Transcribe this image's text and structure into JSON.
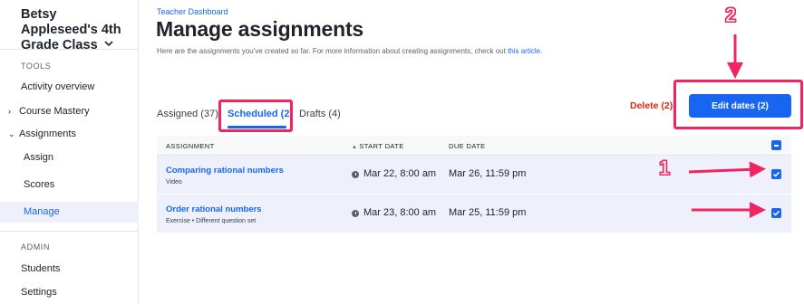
{
  "sidebar": {
    "class_name": "Betsy Appleseed's 4th Grade Class",
    "tools_heading": "TOOLS",
    "items": [
      {
        "label": "Activity overview"
      },
      {
        "label": "Course Mastery"
      },
      {
        "label": "Assignments"
      },
      {
        "label": "Assign"
      },
      {
        "label": "Scores"
      },
      {
        "label": "Manage"
      }
    ],
    "admin_heading": "ADMIN",
    "admin_items": [
      {
        "label": "Students"
      },
      {
        "label": "Settings"
      }
    ]
  },
  "header": {
    "breadcrumb": "Teacher Dashboard",
    "title": "Manage assignments",
    "subtitle": "Here are the assignments you've created so far. For more information about creating assignments, check out ",
    "subtitle_link": "this article",
    "subtitle_end": "."
  },
  "tabs": [
    {
      "label": "Assigned (37)"
    },
    {
      "label": "Scheduled (2)"
    },
    {
      "label": "Drafts (4)"
    }
  ],
  "actions": {
    "delete_label": "Delete (2)",
    "edit_label": "Edit dates (2)"
  },
  "table": {
    "columns": [
      "ASSIGNMENT",
      "START DATE",
      "DUE DATE"
    ],
    "rows": [
      {
        "name": "Comparing rational numbers",
        "meta": "Video",
        "start": "Mar 22, 8:00 am",
        "due": "Mar 26, 11:59 pm"
      },
      {
        "name": "Order rational numbers",
        "meta": "Exercise • Different question set",
        "start": "Mar 23, 8:00 am",
        "due": "Mar 25, 11:59 pm"
      }
    ]
  },
  "annotations": {
    "step1": "1",
    "step2": "2"
  },
  "colors": {
    "accent": "#1865f2",
    "highlight": "#f0255f",
    "delete": "#d92916"
  }
}
